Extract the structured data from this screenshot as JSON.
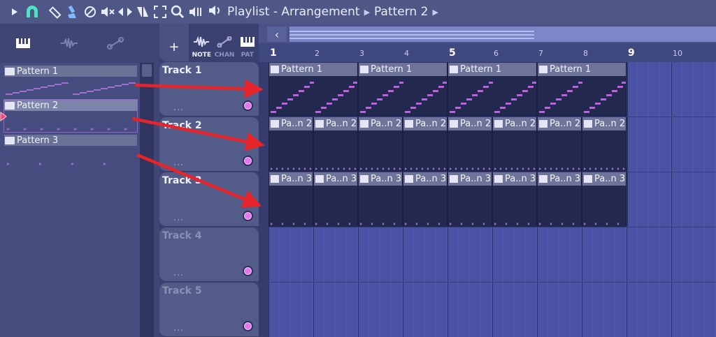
{
  "toolbar": {
    "icons": [
      "play-arrow-icon",
      "magnet-icon",
      "draw-pencil-icon",
      "paint-brush-icon",
      "delete-mute-icon",
      "slip-speaker-icon",
      "flip-arrows-icon",
      "slice-icon",
      "select-icon",
      "zoom-icon",
      "playback-icon"
    ],
    "breadcrumb": {
      "speaker": "speaker-icon",
      "view": "Playlist - Arrangement",
      "pattern": "Pattern 2"
    }
  },
  "picker": {
    "tabs": [
      "piano-keys-icon",
      "audio-wave-icon",
      "automation-curve-icon"
    ],
    "patterns": [
      {
        "name": "Pattern 1"
      },
      {
        "name": "Pattern 2",
        "selected": true
      },
      {
        "name": "Pattern 3"
      }
    ]
  },
  "track_header_tools": {
    "add": "+",
    "labels": [
      "NOTE",
      "CHAN",
      "PAT"
    ]
  },
  "tracks": [
    {
      "name": "Track 1",
      "dots": "..."
    },
    {
      "name": "Track 2",
      "dots": "..."
    },
    {
      "name": "Track 3",
      "dots": "..."
    },
    {
      "name": "Track 4",
      "dots": "..."
    },
    {
      "name": "Track 5",
      "dots": "..."
    }
  ],
  "ruler": [
    "1",
    "2",
    "3",
    "4",
    "5",
    "6",
    "7",
    "8",
    "9",
    "10"
  ],
  "clips": {
    "track1": [
      "Pattern 1",
      "Pattern 1",
      "Pattern 1",
      "Pattern 1"
    ],
    "track2": [
      "Pa..n 2",
      "Pa..n 2",
      "Pa..n 2",
      "Pa..n 2",
      "Pa..n 2",
      "Pa..n 2",
      "Pa..n 2",
      "Pa..n 2"
    ],
    "track3": [
      "Pa..n 3",
      "Pa..n 3",
      "Pa..n 3",
      "Pa..n 3",
      "Pa..n 3",
      "Pa..n 3",
      "Pa..n 3",
      "Pa..n 3"
    ]
  },
  "colors": {
    "arrow": "#e8242b",
    "note": "#c060e0",
    "led": "#e377f2"
  }
}
